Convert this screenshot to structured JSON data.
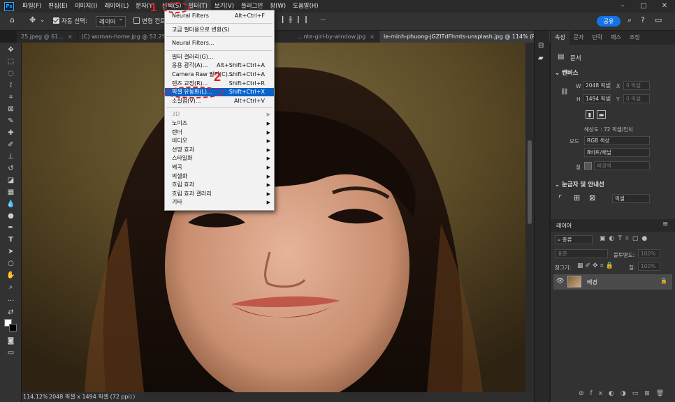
{
  "app": {
    "logo": "Ps"
  },
  "menubar": [
    "파일(F)",
    "편집(E)",
    "이미지(I)",
    "레이어(L)",
    "문자(Y)",
    "선택(S)",
    "필터(T)",
    "보기(V)",
    "플러그인",
    "창(W)",
    "도움말(H)"
  ],
  "window_controls": [
    "–",
    "□",
    "✕"
  ],
  "options": {
    "auto_select_label": "자동 선택:",
    "auto_select_value": "레이어",
    "transform_label": "변형 컨트",
    "share_label": "공유"
  },
  "tabs": [
    {
      "label": "25.jpeg @ 61...",
      "close": "×"
    },
    {
      "label": "(C) woman-home.jpg @ 52.2% (생...",
      "close": ""
    },
    {
      "label": "...nte-girl-by-window.jpg",
      "close": "×"
    },
    {
      "label": "le-minh-phuong-jGZITdFhmts-unsplash.jpg @ 114% (RGB/8) *",
      "close": "×"
    }
  ],
  "status": {
    "zoom": "114.12%",
    "info": "2048 픽셀 x 1494 픽셀 (72 ppi)",
    "arrow": "〉"
  },
  "filter_menu": {
    "items": [
      {
        "label": "Neural Filters",
        "shortcut": "Alt+Ctrl+F",
        "state": "normal",
        "arrow": false
      },
      {
        "sep": true
      },
      {
        "label": "고급 필터용으로 변환(S)",
        "shortcut": "",
        "state": "normal",
        "arrow": false
      },
      {
        "sep": true
      },
      {
        "label": "Neural Filters...",
        "shortcut": "",
        "state": "normal",
        "arrow": false
      },
      {
        "sep": true
      },
      {
        "label": "필터 갤러리(G)...",
        "shortcut": "",
        "state": "normal",
        "arrow": false
      },
      {
        "label": "응용 광각(A)...",
        "shortcut": "Alt+Shift+Ctrl+A",
        "state": "normal",
        "arrow": false
      },
      {
        "label": "Camera Raw 필터(C)...",
        "shortcut": "Shift+Ctrl+A",
        "state": "normal",
        "arrow": false
      },
      {
        "label": "렌즈 교정(R)...",
        "shortcut": "Shift+Ctrl+R",
        "state": "normal",
        "arrow": false
      },
      {
        "label": "픽셀 유동화(L)...",
        "shortcut": "Shift+Ctrl+X",
        "state": "highlight",
        "arrow": false
      },
      {
        "label": "소실점(V)...",
        "shortcut": "Alt+Ctrl+V",
        "state": "normal",
        "arrow": false
      },
      {
        "sep": true
      },
      {
        "label": "3D",
        "shortcut": "",
        "state": "disabled",
        "arrow": true
      },
      {
        "label": "노이즈",
        "shortcut": "",
        "state": "normal",
        "arrow": true
      },
      {
        "label": "렌더",
        "shortcut": "",
        "state": "normal",
        "arrow": true
      },
      {
        "label": "비디오",
        "shortcut": "",
        "state": "normal",
        "arrow": true
      },
      {
        "label": "선명 효과",
        "shortcut": "",
        "state": "normal",
        "arrow": true
      },
      {
        "label": "스타일화",
        "shortcut": "",
        "state": "normal",
        "arrow": true
      },
      {
        "label": "왜곡",
        "shortcut": "",
        "state": "normal",
        "arrow": true
      },
      {
        "label": "픽셀화",
        "shortcut": "",
        "state": "normal",
        "arrow": true
      },
      {
        "label": "흐림 효과",
        "shortcut": "",
        "state": "normal",
        "arrow": true
      },
      {
        "label": "흐림 효과 갤러리",
        "shortcut": "",
        "state": "normal",
        "arrow": true
      },
      {
        "label": "기타",
        "shortcut": "",
        "state": "normal",
        "arrow": true
      }
    ]
  },
  "annotations": {
    "step1": "1",
    "step2": "2",
    "color": "#e02020"
  },
  "properties": {
    "tabs": [
      "속성",
      "문자",
      "단락",
      "패스",
      "조정"
    ],
    "doc_label": "문서",
    "canvas_header": "캔버스",
    "w_label": "W",
    "w_value": "2048 픽셀",
    "h_label": "H",
    "h_value": "1494 픽셀",
    "x_label": "X",
    "x_value": "0 픽셀",
    "y_label": "Y",
    "y_value": "0 픽셀",
    "resolution": "해상도 : 72 픽셀/인치",
    "mode_label": "모드",
    "mode_value": "RGB 색상",
    "depth_value": "8비트/채널",
    "fill_label": "칠",
    "fill_value": "배경색",
    "guides_header": "눈금자 및 안내선",
    "guides_unit": "픽셀"
  },
  "layers": {
    "tab": "레이어",
    "search": "종류",
    "blend": "표준",
    "opacity_label": "불투명도:",
    "opacity_value": "100%",
    "lock_label": "잠그기:",
    "fill_label": "칠:",
    "fill_value": "100%",
    "layer_name": "배경"
  },
  "colors": {
    "accent": "#1473e6",
    "menu_highlight": "#0a63c9",
    "panel": "#323232",
    "dark": "#1e1e1e"
  }
}
